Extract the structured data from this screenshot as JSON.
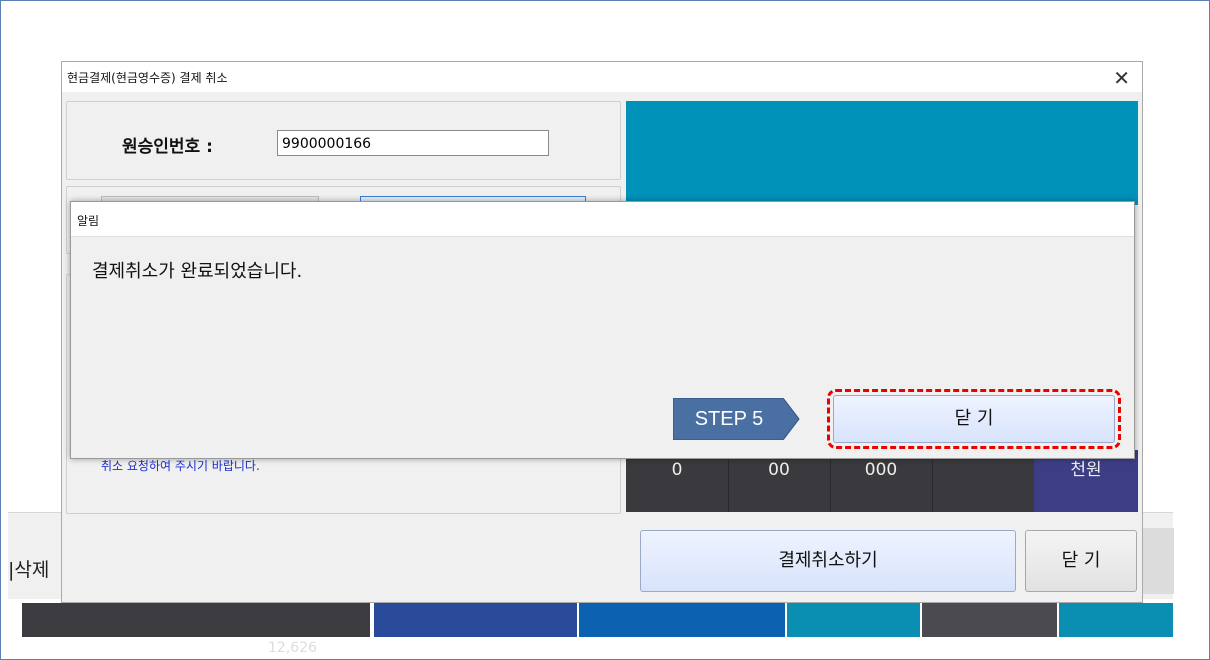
{
  "background": {
    "left_button_label": "|삭제",
    "bottom_number": "12,626"
  },
  "dialog": {
    "title": "현금결제(현금영수증) 결제 취소",
    "close_glyph": "✕",
    "approval_label": "원승인번호 :",
    "approval_value": "9900000166",
    "note": "취소 요청하여 주시기 바랍니다.",
    "keypad": [
      "0",
      "00",
      "000",
      "",
      "천원"
    ],
    "cancel_payment_button": "결제취소하기",
    "close_button": "닫 기"
  },
  "alert": {
    "title": "알림",
    "message": "결제취소가 완료되었습니다.",
    "step_label": "STEP 5",
    "close_button": "닫 기"
  },
  "colors": {
    "teal_panel": "#0092b8",
    "step_badge": "#4a6fa3",
    "highlight": "#e00000"
  }
}
